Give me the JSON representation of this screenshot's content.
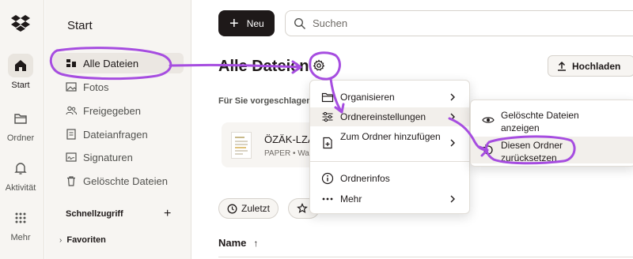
{
  "rail": {
    "items": [
      {
        "label": "Start",
        "icon": "home-icon",
        "active": true
      },
      {
        "label": "Ordner",
        "icon": "folder-icon",
        "active": false
      },
      {
        "label": "Aktivität",
        "icon": "bell-icon",
        "active": false
      },
      {
        "label": "Mehr",
        "icon": "grid-icon",
        "active": false
      }
    ]
  },
  "sidebar": {
    "title": "Start",
    "items": [
      {
        "label": "Alle Dateien",
        "icon": "files-icon",
        "active": true
      },
      {
        "label": "Fotos",
        "icon": "image-icon",
        "active": false
      },
      {
        "label": "Freigegeben",
        "icon": "people-icon",
        "active": false
      },
      {
        "label": "Dateianfragen",
        "icon": "file-request-icon",
        "active": false
      },
      {
        "label": "Signaturen",
        "icon": "signature-icon",
        "active": false
      },
      {
        "label": "Gelöschte Dateien",
        "icon": "trash-icon",
        "active": false
      }
    ],
    "quick_access": "Schnellzugriff",
    "quick_access_add": "+",
    "favorites": "Favoriten"
  },
  "header": {
    "new_button": "Neu",
    "search_placeholder": "Suchen"
  },
  "main": {
    "title": "Alle Dateien",
    "upload_button": "Hochladen",
    "suggested_heading": "Für Sie vorgeschlagen",
    "card": {
      "name": "ÖZÄK-LZÄ",
      "meta": "PAPER • Wa"
    },
    "chips": [
      {
        "label": "Zuletzt",
        "icon": "clock-icon"
      },
      {
        "label": "",
        "icon": "star-icon"
      }
    ],
    "column_header": "Name",
    "sort_arrow": "↑"
  },
  "context_menu": {
    "items": [
      {
        "label": "Organisieren",
        "icon": "folder-icon",
        "submenu": true
      },
      {
        "label": "Ordnereinstellungen",
        "icon": "sliders-icon",
        "submenu": true,
        "highlighted": true
      },
      {
        "label": "Zum Ordner hinzufügen",
        "icon": "add-to-folder-icon",
        "submenu": true
      },
      {
        "label": "Ordnerinfos",
        "icon": "info-icon",
        "submenu": false
      },
      {
        "label": "Mehr",
        "icon": "more-icon",
        "submenu": true
      }
    ]
  },
  "submenu": {
    "items": [
      {
        "label_line1": "Gelöschte Dateien",
        "label_line2": "anzeigen",
        "icon": "eye-icon"
      },
      {
        "label_line1": "Diesen Ordner",
        "label_line2": "zurücksetzen",
        "icon": "reset-icon",
        "highlighted": true
      }
    ]
  },
  "colors": {
    "accent_annotation": "#a64de0",
    "primary_button": "#1e1919",
    "sidebar_bg": "#f7f5f2"
  }
}
